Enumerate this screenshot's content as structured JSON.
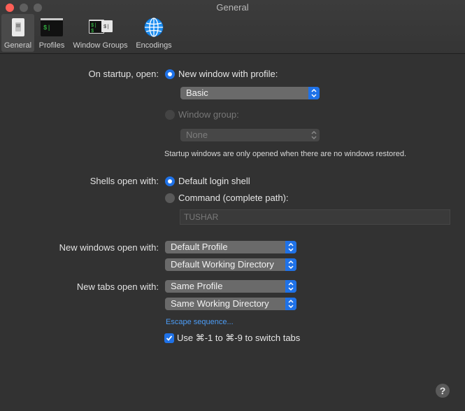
{
  "window": {
    "title": "General"
  },
  "toolbar": {
    "tabs": [
      {
        "label": "General",
        "icon": "general-switch-icon"
      },
      {
        "label": "Profiles",
        "icon": "terminal-icon"
      },
      {
        "label": "Window Groups",
        "icon": "window-groups-icon"
      },
      {
        "label": "Encodings",
        "icon": "globe-icon"
      }
    ],
    "selected": "General"
  },
  "startup": {
    "label": "On startup, open:",
    "new_window_option": "New window with profile:",
    "profile_select": "Basic",
    "window_group_option": "Window group:",
    "group_select": "None",
    "note": "Startup windows are only opened when there are no windows restored."
  },
  "shells": {
    "label": "Shells open with:",
    "default_option": "Default login shell",
    "command_option": "Command (complete path):",
    "command_value": "TUSHAR"
  },
  "new_windows": {
    "label": "New windows open with:",
    "profile_select": "Default Profile",
    "directory_select": "Default Working Directory"
  },
  "new_tabs": {
    "label": "New tabs open with:",
    "profile_select": "Same Profile",
    "directory_select": "Same Working Directory"
  },
  "escape_link": "Escape sequence...",
  "switch_tabs_checkbox": {
    "label": "Use ⌘-1 to ⌘-9 to switch tabs",
    "checked": true
  },
  "help_button": "?",
  "colors": {
    "accent": "#1f72e8",
    "background": "#323232",
    "link": "#4c9cf5"
  }
}
